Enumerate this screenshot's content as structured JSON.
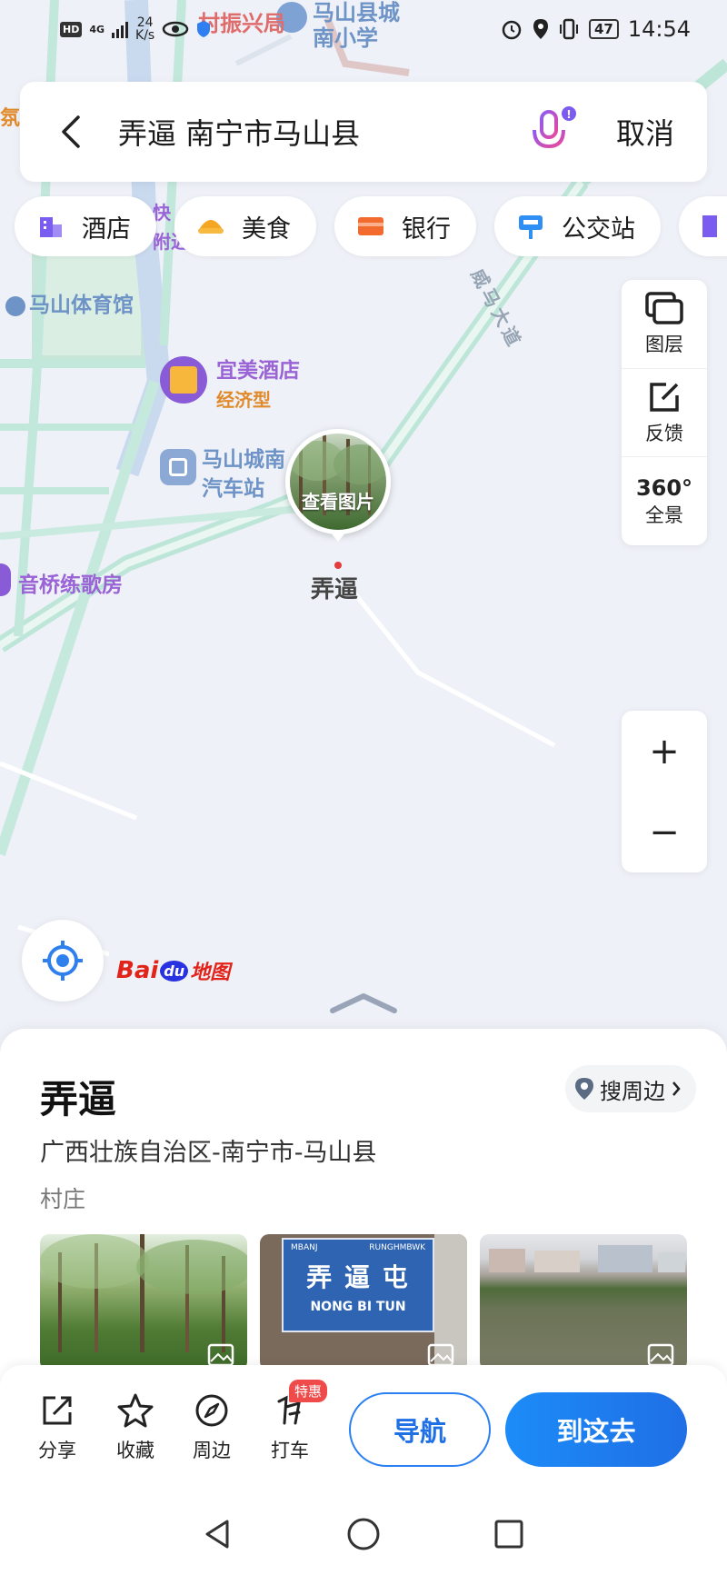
{
  "status_bar": {
    "network": "4G",
    "speed_value": "24",
    "speed_unit": "K/s",
    "battery": "47",
    "time": "14:54"
  },
  "search": {
    "query": "弄逼 南宁市马山县",
    "cancel_label": "取消"
  },
  "chips": [
    {
      "label": "酒店",
      "color": "#7a5cf0"
    },
    {
      "label": "美食",
      "color": "#f5a623"
    },
    {
      "label": "银行",
      "color": "#f26a2e"
    },
    {
      "label": "公交站",
      "color": "#2f8ff3"
    }
  ],
  "map": {
    "pois": {
      "stadium": "马山体育馆",
      "hotel_name": "宜美酒店",
      "hotel_tag": "经济型",
      "bus_station_line1": "马山城南",
      "bus_station_line2": "汽车站",
      "ktv": "音桥练歌房",
      "top_school": "马山县城",
      "top_school_2": "南小学",
      "top_other": "村振兴局",
      "express": "快",
      "express_2": "附近",
      "left_edge": "氛"
    },
    "road_name": "威马大道",
    "pin_caption": "查看图片",
    "pin_label": "弄逼"
  },
  "tools": {
    "layers": "图层",
    "feedback": "反馈",
    "panorama_badge": "360°",
    "panorama": "全景",
    "zoom_in": "+",
    "zoom_out": "−"
  },
  "logo": {
    "brand": "Bai",
    "brand_mid": "du",
    "brand_cn": "地图"
  },
  "place": {
    "title": "弄逼",
    "nearby_label": "搜周边",
    "address": "广西壮族自治区-南宁市-马山县",
    "category": "村庄",
    "sign_top_left": "MBANJ",
    "sign_top_right": "RUNGHMBWK",
    "sign_main": "弄 逼 屯",
    "sign_bottom": "NONG  BI  TUN"
  },
  "actions": {
    "share": "分享",
    "favorite": "收藏",
    "nearby": "周边",
    "taxi": "打车",
    "taxi_promo": "特惠",
    "navigate": "导航",
    "go_here": "到这去"
  },
  "colors": {
    "accent": "#1f6fe5",
    "road": "#b9e4d8",
    "road_main": "#9fdcc9"
  }
}
